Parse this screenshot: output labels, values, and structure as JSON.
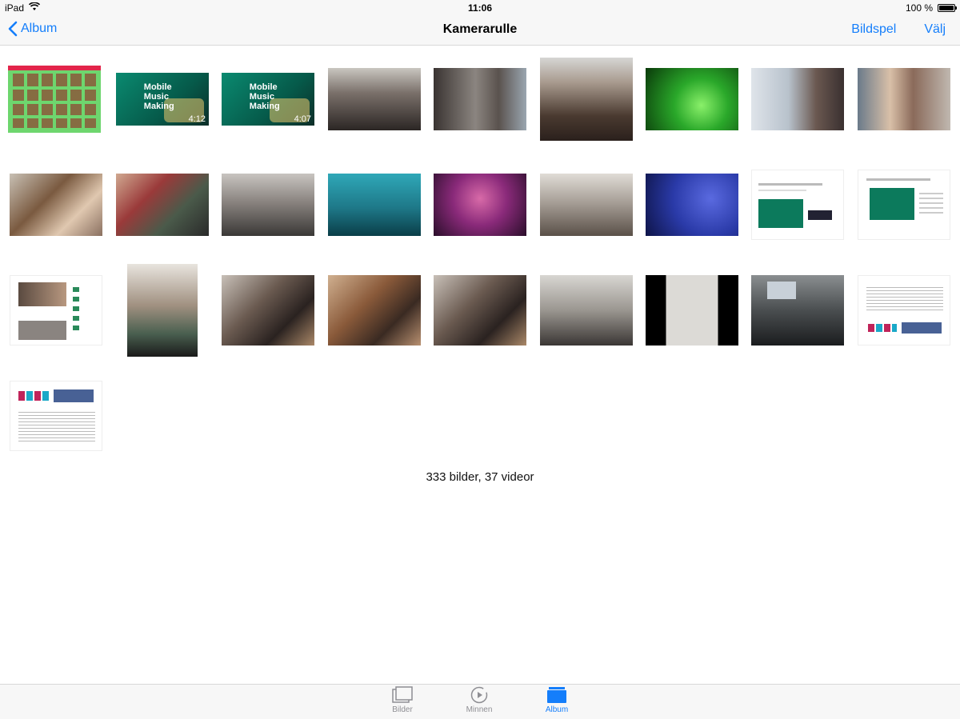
{
  "status": {
    "device": "iPad",
    "time": "11:06",
    "battery": "100 %"
  },
  "nav": {
    "back_label": "Album",
    "title": "Kamerarulle",
    "slideshow_label": "Bildspel",
    "select_label": "Välj"
  },
  "video_overlays": {
    "v1": {
      "duration": "4:12",
      "text": "Mobile Music Making"
    },
    "v2": {
      "duration": "4:07",
      "text": "Mobile Music Making"
    }
  },
  "summary": "333 bilder, 37 videor",
  "tabs": [
    {
      "label": "Bilder",
      "icon": "photos-icon"
    },
    {
      "label": "Minnen",
      "icon": "memories-icon"
    },
    {
      "label": "Album",
      "icon": "album-icon"
    }
  ],
  "colors": {
    "accent": "#147efb",
    "inactive": "#8e8e93",
    "bar_bg": "#f7f7f7"
  }
}
